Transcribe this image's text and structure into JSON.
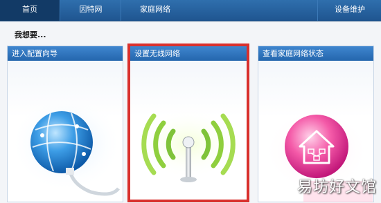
{
  "nav": {
    "items": [
      {
        "label": "首页"
      },
      {
        "label": "因特网"
      },
      {
        "label": "家庭网络"
      },
      {
        "label": "设备维护"
      }
    ]
  },
  "page": {
    "subtitle": "我想要..."
  },
  "cards": [
    {
      "label": "进入配置向导",
      "icon": "globe-plug-icon"
    },
    {
      "label": "设置无线网络",
      "icon": "wireless-antenna-icon"
    },
    {
      "label": "查看家庭网络状态",
      "icon": "home-network-icon"
    }
  ],
  "watermark": "易坊好文馆"
}
